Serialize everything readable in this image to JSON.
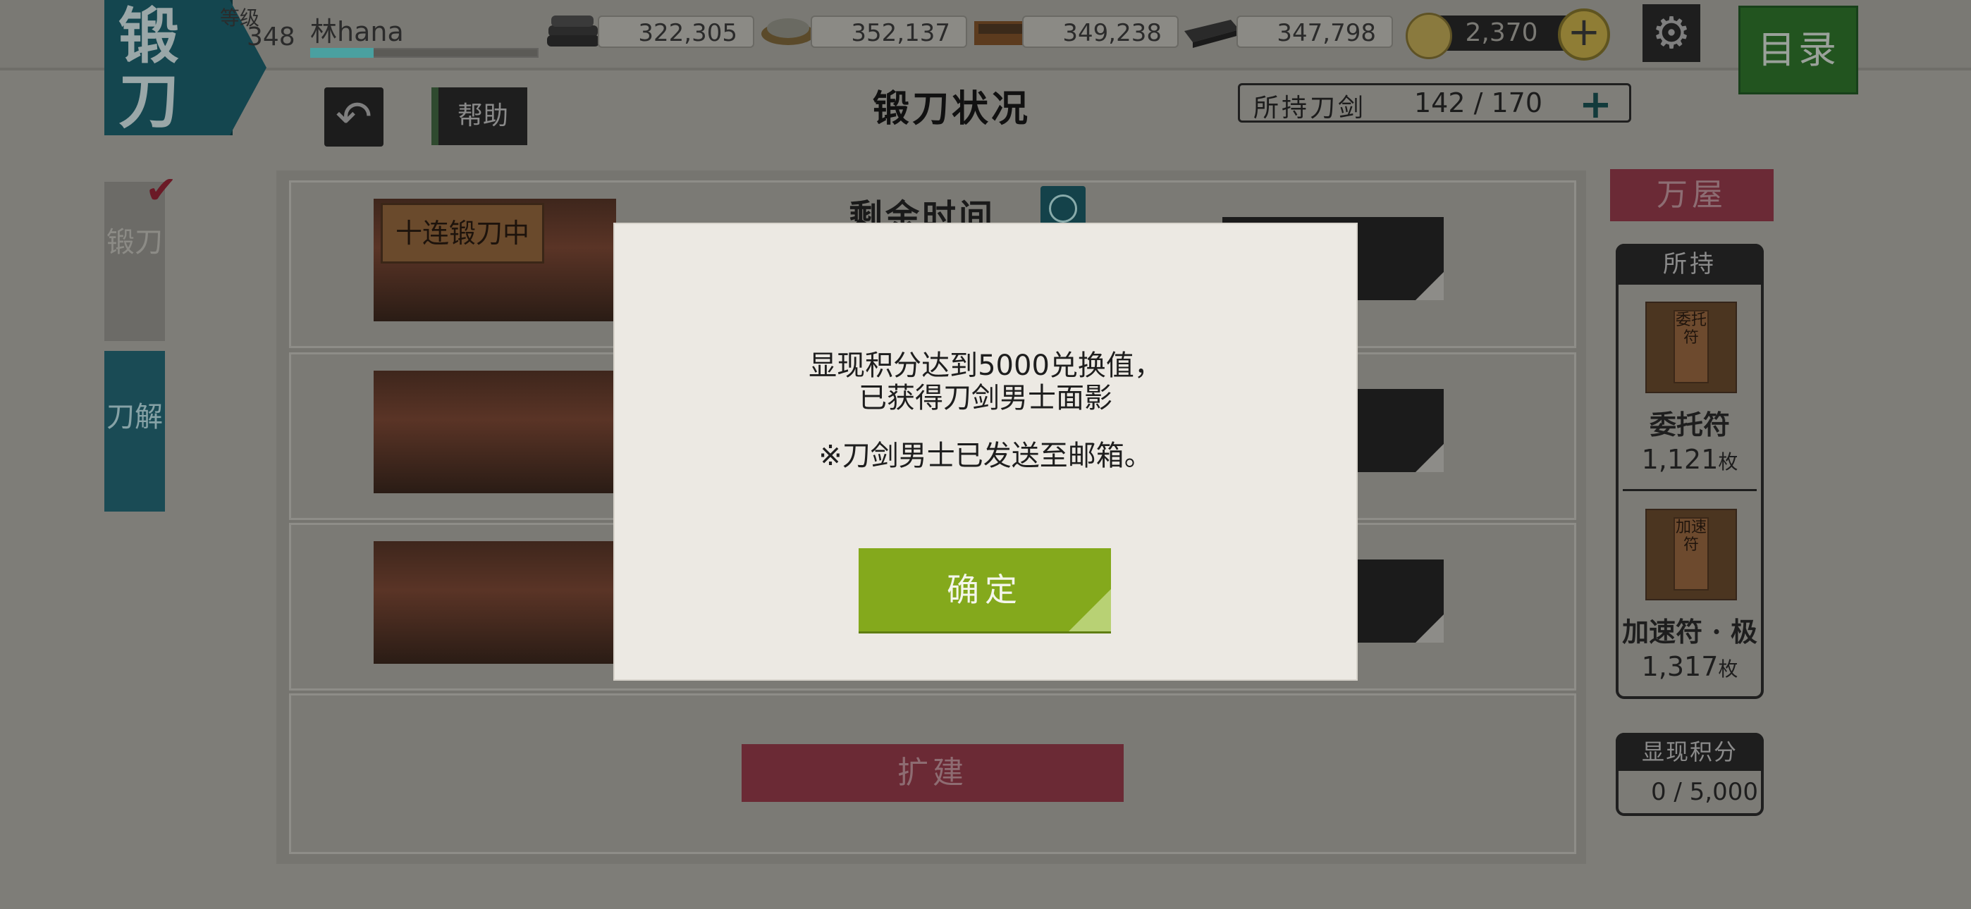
{
  "header": {
    "section_title": "锻刀",
    "level_label": "等级",
    "level_value": "348",
    "player_name": "林hana",
    "resources": [
      {
        "name": "charcoal-icon",
        "value": "322,305"
      },
      {
        "name": "steel-icon",
        "value": "352,137"
      },
      {
        "name": "coolant-icon",
        "value": "349,238"
      },
      {
        "name": "whetstone-icon",
        "value": "347,798"
      }
    ],
    "koban_value": "2,370",
    "koban_plus": "+",
    "menu_label": "目录"
  },
  "subheader": {
    "help_label": "帮助",
    "page_title": "锻刀状况",
    "sword_label": "所持刀剑",
    "sword_value": "142 / 170",
    "sword_plus": "+"
  },
  "tabs": {
    "forge": "锻刀",
    "dismantle": "刀解"
  },
  "forge": {
    "sign_text": "十连锻刀中",
    "remaining_label": "剩余时间",
    "expand_label": "扩建"
  },
  "sidebar": {
    "shop_label": "万屋",
    "owned_header": "所持",
    "items": [
      {
        "tag": "委托符",
        "name": "委托符",
        "count": "1,121",
        "unit": "枚"
      },
      {
        "tag": "加速符",
        "name": "加速符 · 极",
        "count": "1,317",
        "unit": "枚"
      }
    ],
    "score_header": "显现积分",
    "score_value": "0 / 5,000"
  },
  "modal": {
    "line1": "显现积分达到5000兑换值，",
    "line2": "已获得刀剑男士面影",
    "line3": "※刀剑男士已发送至邮箱。",
    "confirm_label": "确定"
  }
}
